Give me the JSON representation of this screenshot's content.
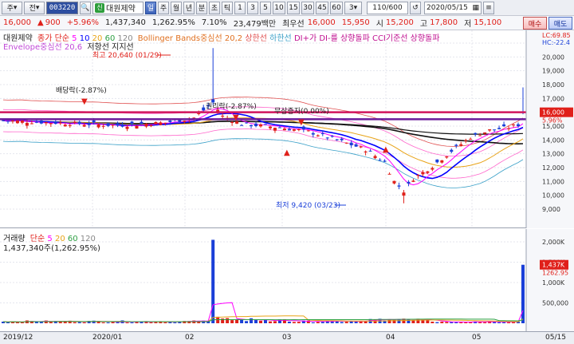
{
  "toolbar": {
    "market_label": "주",
    "all_label": "전",
    "code": "003220",
    "sin_badge": "신",
    "name": "대원제약",
    "periods": [
      "일",
      "주",
      "월",
      "년",
      "분",
      "초",
      "틱"
    ],
    "intervals": [
      "1",
      "3",
      "5",
      "10",
      "15",
      "30",
      "45",
      "60",
      "3"
    ],
    "page": "110/600",
    "date": "2020/05/15",
    "buy_label": "매수",
    "sell_label": "매도"
  },
  "quote": {
    "price": "16,000",
    "change": "900",
    "change_pct": "+5.96%",
    "volume": "1,437,340",
    "volume_ratio": "1,262.95%",
    "turnover": "7.10%",
    "amount": "23,479백만",
    "best_label": "최우선",
    "best_ask": "16,000",
    "best_bid": "15,950",
    "open_label": "시",
    "open": "15,200",
    "high_label": "고",
    "high": "17,800",
    "low_label": "저",
    "low": "15,100"
  },
  "price_legend": {
    "name": "대원제약",
    "ma": "종가 단순",
    "ma_periods": [
      "5",
      "10",
      "20",
      "60",
      "120"
    ],
    "bb": "Bollinger Bands중심선 20,2",
    "bb_upper": "상한선",
    "bb_lower": "하한선",
    "dmi": "DI+가 DI-를 상향돌파",
    "cci": "CCI기준선 상향돌파",
    "envelope": "Envelope중심선 20,6",
    "resistance": "저항선",
    "support": "지지선"
  },
  "annotations": {
    "high_text": "최고 20,640 (01/29)",
    "low_text": "최저 9,420 (03/23)",
    "dividend": "배당락(-2.87%)",
    "rights": "권리락(-2.87%)",
    "bonus": "무상증자(0.00%)"
  },
  "price_axis": {
    "lc": "LC:69.85",
    "hc": "HC:-22.4",
    "ticks": [
      "21,000",
      "20,000",
      "19,000",
      "18,000",
      "17,000",
      "16,000",
      "15,000",
      "14,000",
      "13,000",
      "12,000",
      "11,000",
      "10,000",
      "9,000"
    ],
    "current": "16,000",
    "current_pct": "5.96%"
  },
  "volume_legend": {
    "label": "거래량",
    "ma": "단순",
    "ma_periods": [
      "5",
      "20",
      "60",
      "120"
    ],
    "volume": "1,437,340주(1,262.95%)"
  },
  "volume_axis": {
    "ticks": [
      "2,000K",
      "1,500K",
      "1,000K",
      "500,000"
    ],
    "current": "1,437K",
    "current_pct": "1262.95"
  },
  "x_axis": {
    "labels": [
      "2019/12",
      "2020/01",
      "02",
      "03",
      "04",
      "05",
      "05/15"
    ]
  },
  "colors": {
    "up": "#e0201a",
    "down": "#1a3fd8",
    "ma5": "#ff00ff",
    "ma10": "#0000ff",
    "ma20": "#e8a317",
    "ma60": "#2ea043",
    "ma120": "#888888",
    "bb": "#e05050",
    "envelope": "#ff66cc",
    "resistance": "#d0145c",
    "support": "#6a1b9a"
  }
}
